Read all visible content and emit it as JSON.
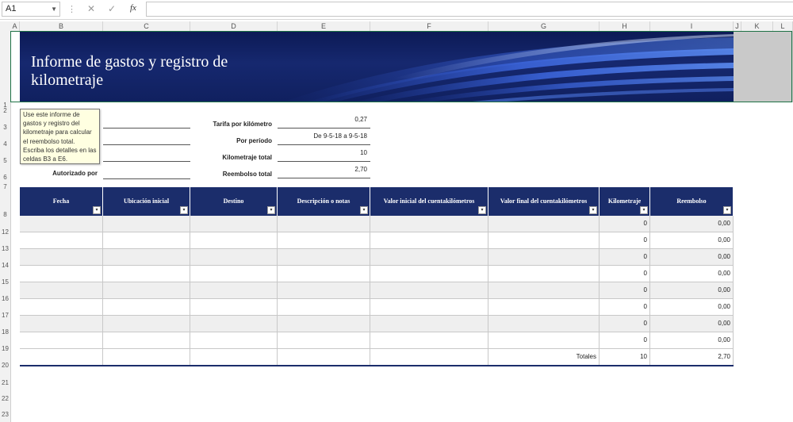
{
  "formula_bar": {
    "name_box": "A1",
    "fx": "fx",
    "cancel": "✕",
    "enter": "✓",
    "separator": "⋮"
  },
  "columns": [
    "A",
    "B",
    "C",
    "D",
    "E",
    "F",
    "G",
    "H",
    "I",
    "J",
    "K",
    "L"
  ],
  "rows": [
    "1",
    "2",
    "3",
    "4",
    "5",
    "6",
    "7",
    "8",
    "12",
    "13",
    "14",
    "15",
    "16",
    "17",
    "18",
    "19",
    "20",
    "21",
    "22",
    "23"
  ],
  "banner": {
    "title": "Informe de gastos y registro de kilometraje"
  },
  "tooltip": "Use este informe de gastos y registro del kilometraje para calcular el reembolso total. Escriba los detalles en las celdas B3 a E6.",
  "info": {
    "authorized_label": "Autorizado por",
    "rate_label": "Tarifa por kilómetro",
    "rate_value": "0,27 ",
    "period_label": "Por período",
    "period_value": "De 9-5-18 a 9-5-18",
    "mileage_label": "Kilometraje total",
    "mileage_value": "10",
    "reimb_label": "Reembolso total",
    "reimb_value": "2,70 "
  },
  "table": {
    "headers": [
      "Fecha",
      "Ubicación inicial",
      "Destino",
      "Descripción o notas",
      "Valor inicial del cuentakilómetros",
      "Valor final del cuentakilómetros",
      "Kilometraje",
      "Reembolso"
    ],
    "rows": [
      {
        "km": "0",
        "reimb": "0,00 "
      },
      {
        "km": "0",
        "reimb": "0,00 "
      },
      {
        "km": "0",
        "reimb": "0,00 "
      },
      {
        "km": "0",
        "reimb": "0,00 "
      },
      {
        "km": "0",
        "reimb": "0,00 "
      },
      {
        "km": "0",
        "reimb": "0,00 "
      },
      {
        "km": "0",
        "reimb": "0,00 "
      },
      {
        "km": "0",
        "reimb": "0,00 "
      }
    ],
    "totals": {
      "label": "Totales",
      "km": "10",
      "reimb": "2,70 "
    },
    "filter_glyph": "▾"
  },
  "colors": {
    "header_navy": "#1b2d6b",
    "banner_navy": "#10205f",
    "accent_blue": "#3a5fd0",
    "selection_green": "#1e7145"
  }
}
